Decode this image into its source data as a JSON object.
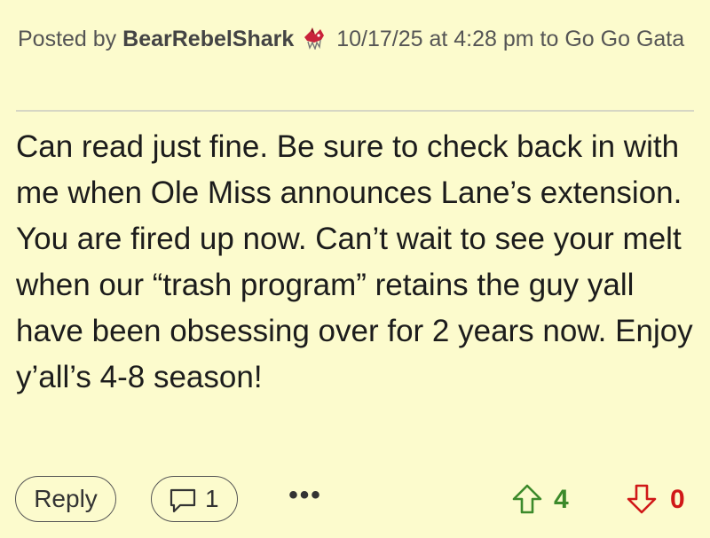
{
  "post": {
    "posted_by_prefix": "Posted by",
    "author": "BearRebelShark",
    "badge_icon": "shark-avatar-icon",
    "timestamp": "10/17/25 at 4:28 pm",
    "to_prefix": "to",
    "recipient": "Go Go Gata",
    "body": "Can read just fine. Be sure to check back in with me when Ole Miss announces Lane’s extension. You are fired up now. Can’t wait to see your melt when our “trash program” retains the guy yall have been obsessing over for 2 years now. Enjoy y’all’s 4-8 season!"
  },
  "actions": {
    "reply_label": "Reply",
    "comment_icon": "comment-bubble-icon",
    "comment_count": "1",
    "more_label": "•••",
    "upvote_icon": "arrow-up-icon",
    "upvote_count": "4",
    "downvote_icon": "arrow-down-icon",
    "downvote_count": "0"
  },
  "colors": {
    "background": "#fcfbcd",
    "upvote": "#3c8a2b",
    "downvote": "#d01818"
  }
}
